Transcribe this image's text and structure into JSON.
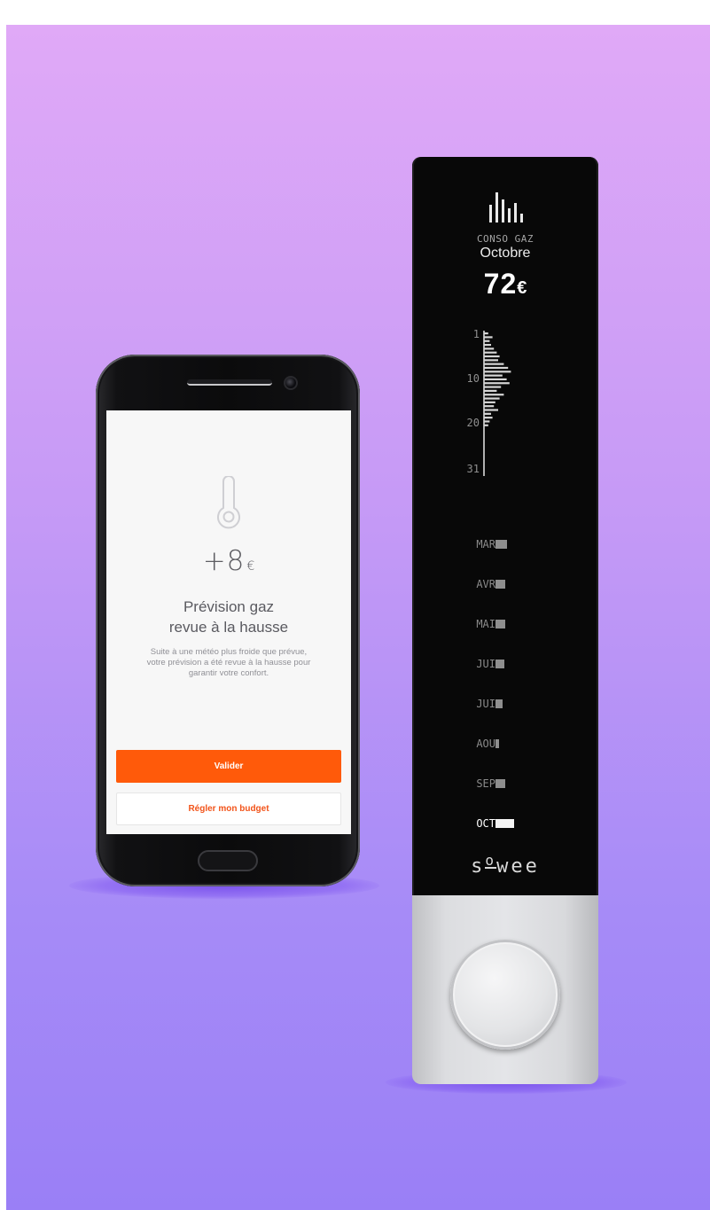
{
  "phone": {
    "forecast": {
      "amount": "+8",
      "currency": "€",
      "title_line1": "Prévision gaz",
      "title_line2": "revue à la hausse",
      "description": "Suite à une météo plus froide que prévue, votre prévision a été revue à la hausse pour garantir votre confort."
    },
    "buttons": {
      "validate_label": "Valider",
      "budget_label": "Régler mon budget"
    },
    "icons": {
      "forecast_icon": "thermometer-icon"
    },
    "colors": {
      "accent": "#ff5a0a",
      "screen_bg": "#f7f7f7"
    }
  },
  "device": {
    "header_label": "CONSO GAZ",
    "month": "Octobre",
    "amount": "72",
    "currency": "€",
    "brand": "sowee",
    "icons": {
      "header_icon": "bar-chart-icon"
    },
    "daily_axis_labels": [
      "1",
      "10",
      "20",
      "31"
    ],
    "daily_values": [
      0.15,
      0.3,
      0.2,
      0.25,
      0.35,
      0.45,
      0.55,
      0.5,
      0.7,
      0.85,
      0.95,
      0.65,
      0.8,
      0.9,
      0.6,
      0.45,
      0.7,
      0.55,
      0.4,
      0.35,
      0.5,
      0.25,
      0.3,
      0.2,
      0.15
    ],
    "months": [
      {
        "label": "MAR",
        "level": 0.9,
        "active": false
      },
      {
        "label": "AVR",
        "level": 0.82,
        "active": false
      },
      {
        "label": "MAI",
        "level": 0.82,
        "active": false
      },
      {
        "label": "JUI",
        "level": 0.72,
        "active": false
      },
      {
        "label": "JUI",
        "level": 0.55,
        "active": false
      },
      {
        "label": "AOU",
        "level": 0.3,
        "active": false
      },
      {
        "label": "SEP",
        "level": 0.82,
        "active": false
      },
      {
        "label": "OCT",
        "level": 1.5,
        "active": true
      }
    ],
    "colors": {
      "panel": "#080808",
      "bar": "#8e8e8e",
      "bar_active": "#f4f4f4"
    }
  }
}
